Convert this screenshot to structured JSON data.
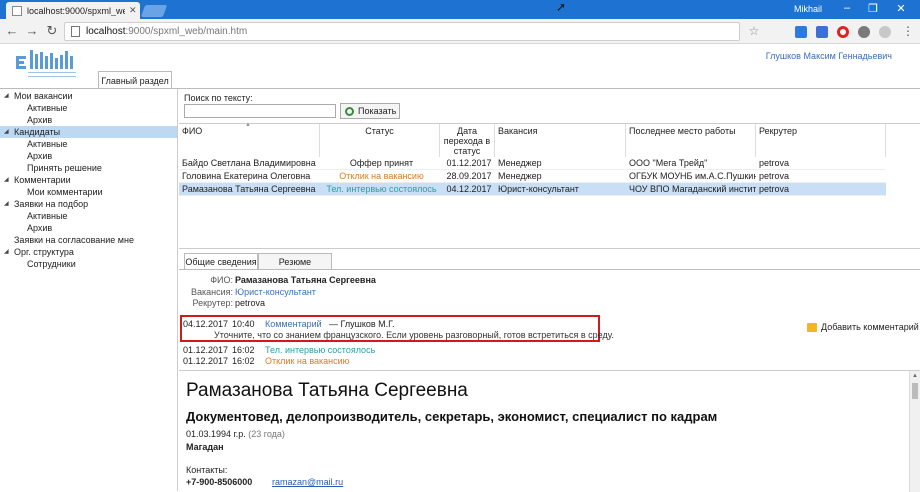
{
  "browser": {
    "tab_title": "localhost:9000/spxml_we",
    "user": "Mikhail",
    "url_host": "localhost",
    "url_path": ":9000/spxml_web/main.htm"
  },
  "header": {
    "user_name": "Глушков Максим Геннадьевич",
    "main_tab": "Главный раздел"
  },
  "sidebar": {
    "items": [
      {
        "label": "Мои вакансии",
        "level": 0,
        "expanded": true
      },
      {
        "label": "Активные",
        "level": 1
      },
      {
        "label": "Архив",
        "level": 1
      },
      {
        "label": "Кандидаты",
        "level": 0,
        "expanded": true,
        "selected": true
      },
      {
        "label": "Активные",
        "level": 1
      },
      {
        "label": "Архив",
        "level": 1
      },
      {
        "label": "Принять решение",
        "level": 1
      },
      {
        "label": "Комментарии",
        "level": 0,
        "expanded": true
      },
      {
        "label": "Мои комментарии",
        "level": 1
      },
      {
        "label": "Заявки на подбор",
        "level": 0,
        "expanded": true
      },
      {
        "label": "Активные",
        "level": 1
      },
      {
        "label": "Архив",
        "level": 1
      },
      {
        "label": "Заявки на согласование мне",
        "level": 0
      },
      {
        "label": "Орг. структура",
        "level": 0,
        "expanded": true
      },
      {
        "label": "Сотрудники",
        "level": 1
      }
    ]
  },
  "search": {
    "label": "Поиск по тексту:",
    "value": "",
    "button": "Показать"
  },
  "grid": {
    "columns": [
      "ФИО",
      "Статус",
      "Дата перехода в статус",
      "Вакансия",
      "Последнее место работы",
      "Рекрутер"
    ],
    "rows": [
      {
        "fio": "Байдо Светлана Владимировна",
        "status": "Оффер принят",
        "status_color": "#222222",
        "date": "01.12.2017",
        "vacancy": "Менеджер",
        "last_job": "ООО \"Мега Трейд\"",
        "recruiter": "petrova"
      },
      {
        "fio": "Головина Екатерина Олеговна",
        "status": "Отклик на вакансию",
        "status_color": "#e07b1e",
        "date": "28.09.2017",
        "vacancy": "Менеджер",
        "last_job": "ОГБУК МОУНБ им.А.С.Пушкина",
        "recruiter": "petrova"
      },
      {
        "fio": "Рамазанова Татьяна Сергеевна",
        "status": "Тел. интервью состоялось",
        "status_color": "#2a9fa0",
        "date": "04.12.2017",
        "vacancy": "Юрист-консультант",
        "last_job": "ЧОУ ВПО Магаданский инстит...",
        "recruiter": "petrova",
        "selected": true
      }
    ]
  },
  "details": {
    "tabs": [
      "Общие сведения",
      "Резюме"
    ],
    "fio_label": "ФИО:",
    "fio": "Рамазанова Татьяна Сергеевна",
    "vacancy_label": "Вакансия:",
    "vacancy": "Юрист-консультант",
    "recruiter_label": "Рекрутер:",
    "recruiter": "petrova",
    "add_comment": "Добавить комментарий",
    "history": [
      {
        "date": "04.12.2017",
        "time": "10:40",
        "type": "Комментарий",
        "type_color": "#3b6fb6",
        "author": "— Глушков М.Г.",
        "text": "Уточните, что со знанием французского. Если уровень разговорный, готов встретиться в среду."
      },
      {
        "date": "01.12.2017",
        "time": "16:02",
        "type": "Тел. интервью состоялось",
        "type_color": "#2a9fa0"
      },
      {
        "date": "01.12.2017",
        "time": "16:02",
        "type": "Отклик на вакансию",
        "type_color": "#e07b1e"
      }
    ]
  },
  "resume": {
    "name": "Рамазанова Татьяна Сергеевна",
    "position": "Документовед, делопроизводитель, секретарь, экономист, специалист по кадрам",
    "birth": "01.03.1994 г.р.",
    "age": "(23 года)",
    "city": "Магадан",
    "contacts_label": "Контакты:",
    "phone": "+7-900-8506000",
    "email": "ramazan@mail.ru"
  }
}
